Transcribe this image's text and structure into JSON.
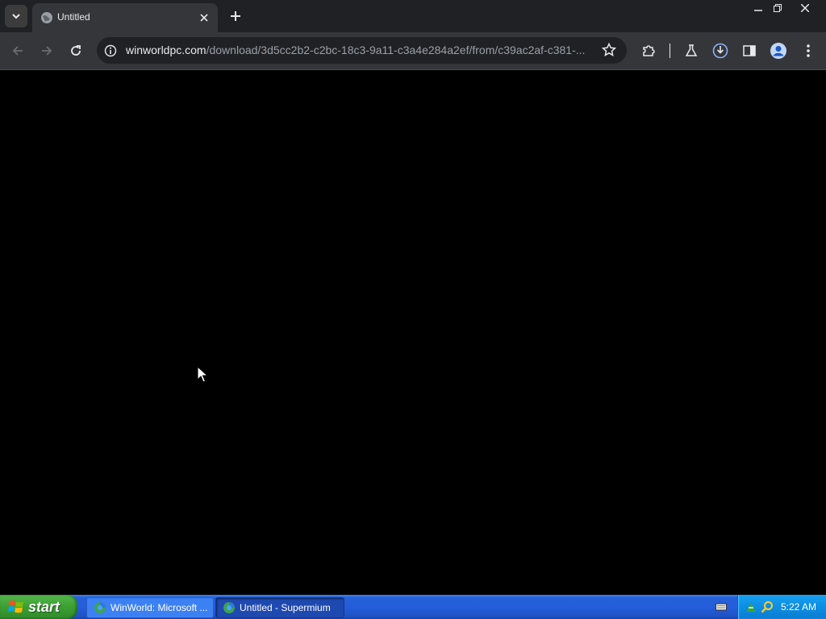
{
  "browser": {
    "tab": {
      "title": "Untitled",
      "icon": "globe-icon"
    },
    "new_tab_icon": "plus-icon",
    "tab_search_icon": "chevron-down-icon",
    "window_controls": [
      "minimize-icon",
      "restore-icon",
      "close-icon"
    ],
    "omnibox": {
      "host": "winworldpc.com",
      "path": "/download/3d5cc2b2-c2bc-18c3-9a11-c3a4e284a2ef/from/c39ac2af-c381-...",
      "info_icon": "info-icon",
      "bookmark_icon": "star-icon"
    },
    "toolbar_icons": [
      "back-icon",
      "forward-icon",
      "reload-icon",
      "extensions-icon",
      "labs-icon",
      "download-icon",
      "side-panel-icon",
      "profile-icon",
      "menu-icon"
    ],
    "colors": {
      "frame": "#202124",
      "toolbar": "#35363a",
      "content": "#000000"
    }
  },
  "taskbar": {
    "start_label": "start",
    "tasks": [
      {
        "label": "WinWorld: Microsoft ...",
        "active": false
      },
      {
        "label": "Untitled - Supermium",
        "active": true
      }
    ],
    "clock": "5:22 AM",
    "colors": {
      "bar": "#245edb",
      "start": "#3c9f33",
      "tray": "#0d8ee2"
    }
  }
}
